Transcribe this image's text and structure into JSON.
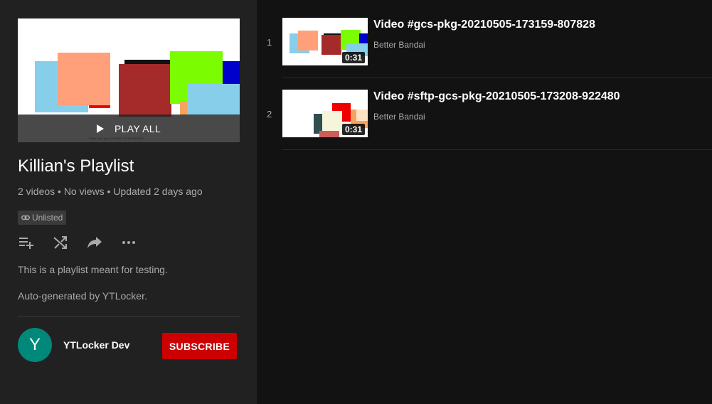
{
  "playlist": {
    "title": "Killian's Playlist",
    "stats": "2 videos • No views • Updated 2 days ago",
    "privacy_badge": "Unlisted",
    "play_all_label": "PLAY ALL",
    "description": "This is a playlist meant for testing.",
    "auto_generated": "Auto-generated by YTLocker.",
    "hero_caption": "Video #gcs-pkg-20210505-173159-807828"
  },
  "owner": {
    "avatar_letter": "Y",
    "name": "YTLocker Dev",
    "subscribe_label": "SUBSCRIBE"
  },
  "actions": [
    "add-to-queue-icon",
    "shuffle-icon",
    "share-icon",
    "more-icon"
  ],
  "videos": [
    {
      "index": "1",
      "title": "Video #gcs-pkg-20210505-173159-807828",
      "channel": "Better Bandai",
      "duration": "0:31"
    },
    {
      "index": "2",
      "title": "Video #sftp-gcs-pkg-20210505-173208-922480",
      "channel": "Better Bandai",
      "duration": "0:31"
    }
  ],
  "colors": {
    "sidebar_bg": "#212121",
    "main_bg": "#121212",
    "subscribe": "#cc0000",
    "avatar": "#00897b"
  }
}
